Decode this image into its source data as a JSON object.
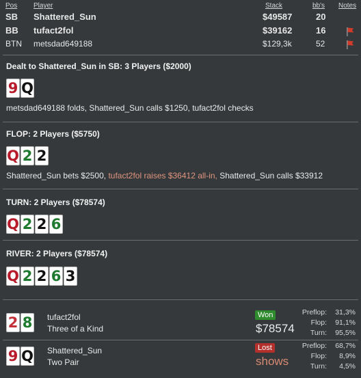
{
  "header": {
    "pos": "Pos",
    "player": "Player",
    "stack": "Stack",
    "bbs": "bb's",
    "notes": "Notes"
  },
  "players": [
    {
      "pos": "SB",
      "name": "Shattered_Sun",
      "stack": "$49587",
      "bbs": "20",
      "flag": false
    },
    {
      "pos": "BB",
      "name": "tufact2fol",
      "stack": "$39162",
      "bbs": "16",
      "flag": true
    },
    {
      "pos": "BTN",
      "name": "metsdad649188",
      "stack": "$129,3k",
      "bbs": "52",
      "flag": true
    }
  ],
  "preflop": {
    "title": "Dealt to Shattered_Sun in SB: 3 Players ($2000)",
    "cards": [
      {
        "rank": "9",
        "suit": "h"
      },
      {
        "rank": "Q",
        "suit": "s"
      }
    ],
    "action": "metsdad649188 folds, Shattered_Sun calls $1250, tufact2fol checks"
  },
  "flop": {
    "title": "FLOP: 2 Players ($5750)",
    "cards": [
      {
        "rank": "Q",
        "suit": "h"
      },
      {
        "rank": "2",
        "suit": "c"
      },
      {
        "rank": "2",
        "suit": "s"
      }
    ],
    "action_a": "Shattered_Sun bets $2500, ",
    "action_b": "tufact2fol raises $36412 all-in,",
    "action_c": " Shattered_Sun calls $33912"
  },
  "turn": {
    "title": "TURN: 2 Players ($78574)",
    "cards": [
      {
        "rank": "Q",
        "suit": "h"
      },
      {
        "rank": "2",
        "suit": "c"
      },
      {
        "rank": "2",
        "suit": "s"
      },
      {
        "rank": "6",
        "suit": "c"
      }
    ]
  },
  "river": {
    "title": "RIVER: 2 Players ($78574)",
    "cards": [
      {
        "rank": "Q",
        "suit": "h"
      },
      {
        "rank": "2",
        "suit": "c"
      },
      {
        "rank": "2",
        "suit": "s"
      },
      {
        "rank": "6",
        "suit": "c"
      },
      {
        "rank": "3",
        "suit": "s"
      }
    ]
  },
  "results": [
    {
      "name": "tufact2fol",
      "hand": "Three of a Kind",
      "badge": "Won",
      "amount": "$78574",
      "cards": [
        {
          "rank": "2",
          "suit": "d"
        },
        {
          "rank": "8",
          "suit": "c"
        }
      ],
      "stats": [
        {
          "label": "Preflop:",
          "value": "31,3%"
        },
        {
          "label": "Flop:",
          "value": "91,1%"
        },
        {
          "label": "Turn:",
          "value": "95,5%"
        }
      ]
    },
    {
      "name": "Shattered_Sun",
      "hand": "Two Pair",
      "badge": "Lost",
      "amount": "shows",
      "cards": [
        {
          "rank": "9",
          "suit": "h"
        },
        {
          "rank": "Q",
          "suit": "s"
        }
      ],
      "stats": [
        {
          "label": "Preflop:",
          "value": "68,7%"
        },
        {
          "label": "Flop:",
          "value": "8,9%"
        },
        {
          "label": "Turn:",
          "value": "4,5%"
        }
      ]
    }
  ],
  "icons": {
    "note_flag": "red-flag-icon"
  },
  "colors": {
    "background": "#35393b",
    "highlight": "#e0957f",
    "won": "#2e8b2e",
    "lost": "#b3302d"
  }
}
